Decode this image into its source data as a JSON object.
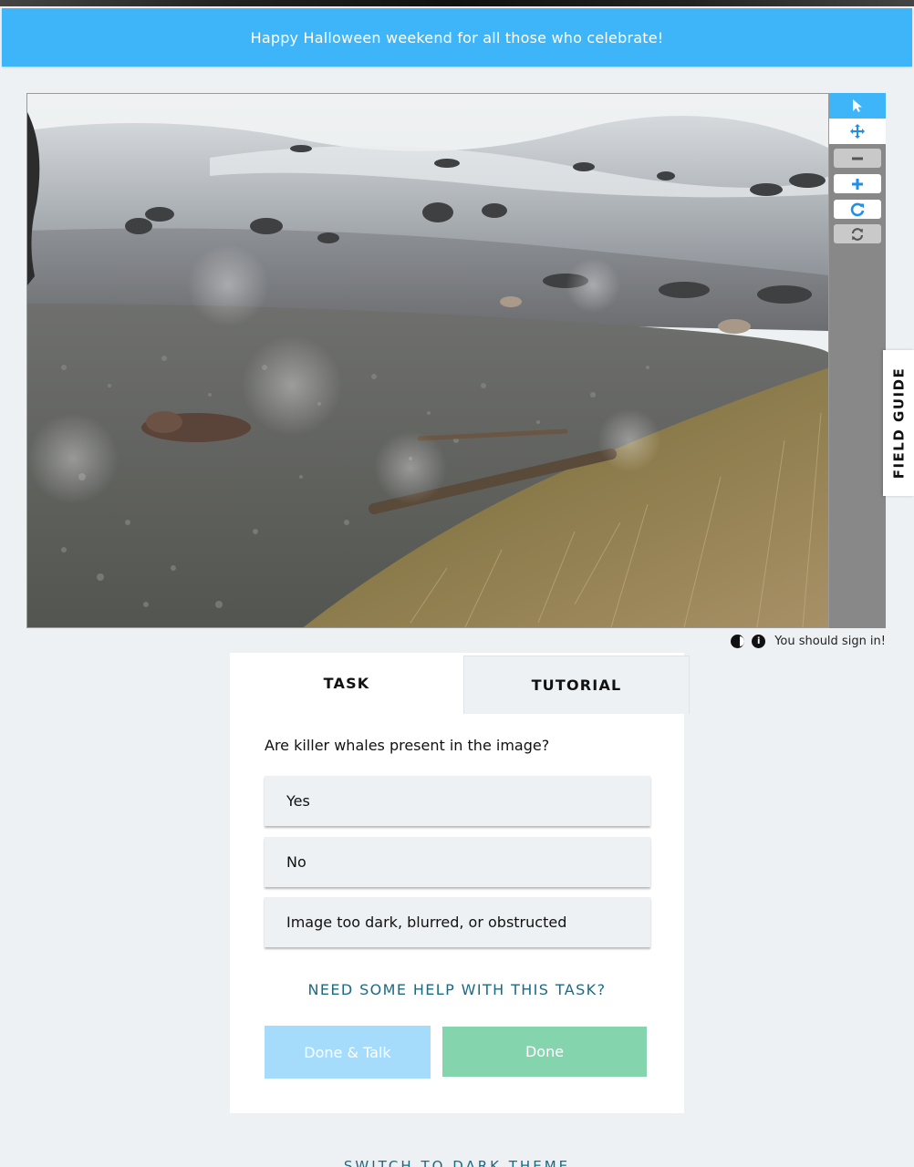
{
  "banner": {
    "text": "Happy Halloween weekend for all those who celebrate!"
  },
  "subject_viewer": {
    "image_alt": "Camera trap photo of a rocky beach with seals and grass slope",
    "tools": [
      {
        "name": "annotate",
        "icon": "pointer-icon",
        "active": true
      },
      {
        "name": "move",
        "icon": "move-arrows-icon",
        "active": false
      },
      {
        "name": "zoom-out",
        "icon": "minus-icon",
        "disabled": true
      },
      {
        "name": "zoom-in",
        "icon": "plus-icon"
      },
      {
        "name": "rotate",
        "icon": "rotate-icon"
      },
      {
        "name": "reset",
        "icon": "refresh-icon",
        "disabled": true
      }
    ]
  },
  "field_guide": {
    "label": "FIELD GUIDE"
  },
  "meta": {
    "signin_text": "You should sign in!"
  },
  "tabs": {
    "task": "TASK",
    "tutorial": "TUTORIAL"
  },
  "task": {
    "question": "Are killer whales present in the image?",
    "answers": [
      "Yes",
      "No",
      "Image too dark, blurred, or obstructed"
    ],
    "help_link": "NEED SOME HELP WITH THIS TASK?",
    "done_talk": "Done & Talk",
    "done": "Done"
  },
  "footer": {
    "theme_toggle": "SWITCH TO DARK THEME"
  },
  "colors": {
    "banner": "#3fb5f9",
    "done": "#84d4ae",
    "done_talk": "#a6dcfb",
    "link": "#1b6a84",
    "page_bg": "#eef1f4"
  }
}
